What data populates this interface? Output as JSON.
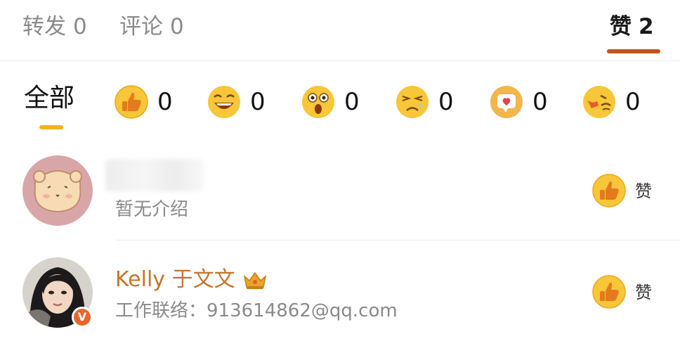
{
  "tabs": [
    {
      "label": "转发",
      "count": "0"
    },
    {
      "label": "评论",
      "count": "0"
    },
    {
      "label": "赞",
      "count": "2"
    }
  ],
  "active_tab": "赞",
  "filter": {
    "all_label": "全部",
    "reactions": [
      {
        "icon": "thumbs-up-icon",
        "count": "0"
      },
      {
        "icon": "laughing-face-icon",
        "count": "0"
      },
      {
        "icon": "surprised-face-icon",
        "count": "0"
      },
      {
        "icon": "sad-face-icon",
        "count": "0"
      },
      {
        "icon": "heart-hug-icon",
        "count": "0"
      },
      {
        "icon": "angry-face-icon",
        "count": "0"
      }
    ]
  },
  "users": [
    {
      "name": "",
      "intro": "暂无介绍",
      "like_label": "赞",
      "avatar": "bear-avatar"
    },
    {
      "name": "Kelly 于文文",
      "intro": "工作联络：913614862@qq.com",
      "like_label": "赞",
      "avatar": "photo-avatar",
      "badge": "V"
    }
  ],
  "colors": {
    "accent": "#c0541c",
    "filter_underline": "#f2b21c",
    "name_color": "#c2752b",
    "emoji_yellow": "#f6c531"
  }
}
